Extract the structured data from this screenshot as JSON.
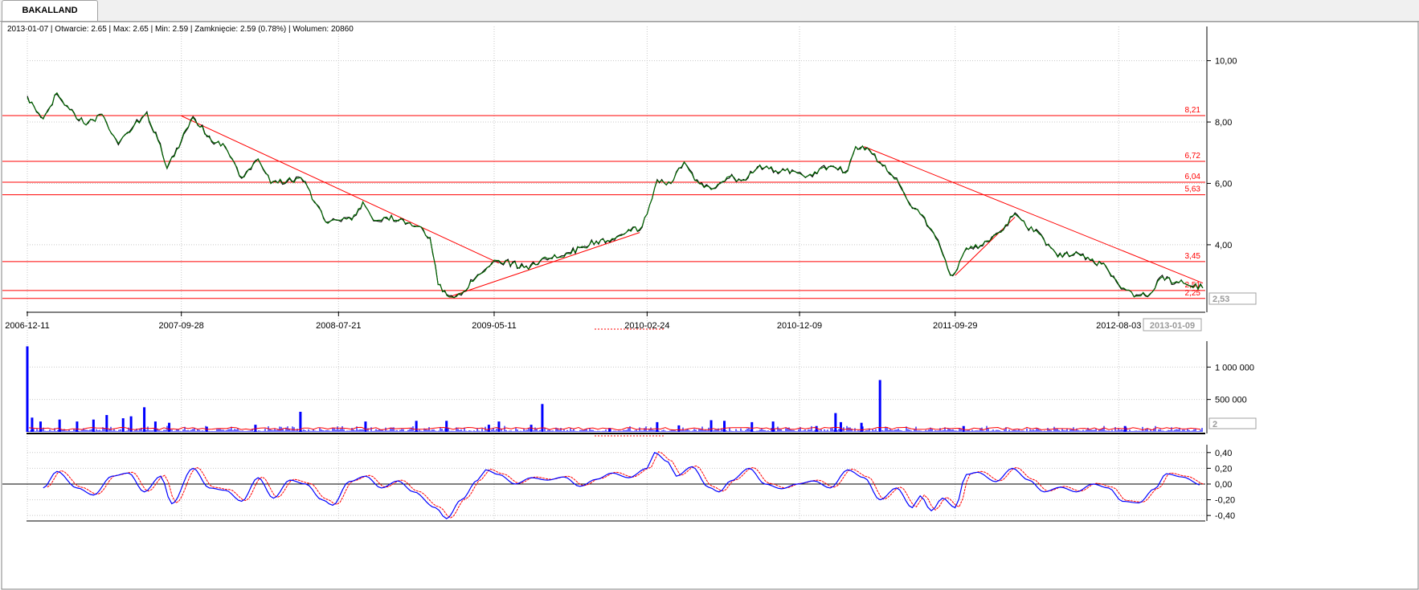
{
  "tab": {
    "label": "BAKALLAND"
  },
  "info_bar": "2013-01-07 | Otwarcie: 2.65 | Max: 2.65 | Min: 2.59 | Zamknięcie: 2.59 (0.78%)  | Wolumen: 20860",
  "colors": {
    "price_line": "#006400",
    "price_high_low": "#000000",
    "level_line": "#ff0000",
    "volume_bar": "#0000ff",
    "volume_ma": "#ff0000",
    "osc_main": "#0000ff",
    "osc_signal": "#ff0000",
    "grid": "#c8c8c8"
  },
  "chart_data": {
    "type": "line",
    "x_labels": [
      "2006-12-11",
      "2007-09-28",
      "2008-07-21",
      "2009-05-11",
      "2010-02-24",
      "2010-12-09",
      "2011-09-29",
      "2012-08-03"
    ],
    "x_range": [
      "2006-12-11",
      "2013-01-09"
    ],
    "current_date_label": "2013-01-09",
    "price_panel": {
      "y_ticks": [
        "10,00",
        "8,00",
        "6,00",
        "4,00"
      ],
      "ylim": [
        1.8,
        10.8
      ],
      "series": [
        {
          "name": "",
          "points": [
            [
              "2006-12-11",
              8.8
            ],
            [
              "2007-01-10",
              8.1
            ],
            [
              "2007-02-05",
              8.95
            ],
            [
              "2007-03-01",
              8.4
            ],
            [
              "2007-04-01",
              7.9
            ],
            [
              "2007-05-01",
              8.25
            ],
            [
              "2007-06-01",
              7.3
            ],
            [
              "2007-07-01",
              7.9
            ],
            [
              "2007-07-25",
              8.3
            ],
            [
              "2007-08-15",
              7.4
            ],
            [
              "2007-09-01",
              6.5
            ],
            [
              "2007-09-28",
              7.4
            ],
            [
              "2007-10-20",
              8.15
            ],
            [
              "2007-11-20",
              7.5
            ],
            [
              "2007-12-20",
              7.2
            ],
            [
              "2008-01-20",
              6.2
            ],
            [
              "2008-02-20",
              6.8
            ],
            [
              "2008-03-15",
              6.0
            ],
            [
              "2008-04-15",
              6.1
            ],
            [
              "2008-05-15",
              6.1
            ],
            [
              "2008-06-10",
              5.3
            ],
            [
              "2008-07-01",
              4.7
            ],
            [
              "2008-07-21",
              4.8
            ],
            [
              "2008-08-15",
              4.8
            ],
            [
              "2008-09-05",
              5.4
            ],
            [
              "2008-09-25",
              4.8
            ],
            [
              "2008-10-20",
              4.9
            ],
            [
              "2008-11-20",
              4.8
            ],
            [
              "2008-12-20",
              4.6
            ],
            [
              "2009-01-10",
              4.2
            ],
            [
              "2009-01-25",
              2.7
            ],
            [
              "2009-02-15",
              2.3
            ],
            [
              "2009-03-10",
              2.4
            ],
            [
              "2009-04-10",
              3.0
            ],
            [
              "2009-05-11",
              3.5
            ],
            [
              "2009-06-15",
              3.4
            ],
            [
              "2009-07-15",
              3.2
            ],
            [
              "2009-08-15",
              3.6
            ],
            [
              "2009-09-20",
              3.6
            ],
            [
              "2009-10-20",
              3.9
            ],
            [
              "2009-11-20",
              4.1
            ],
            [
              "2009-12-20",
              4.2
            ],
            [
              "2010-01-20",
              4.5
            ],
            [
              "2010-02-10",
              4.5
            ],
            [
              "2010-02-24",
              5.0
            ],
            [
              "2010-03-15",
              6.1
            ],
            [
              "2010-04-10",
              6.0
            ],
            [
              "2010-05-05",
              6.7
            ],
            [
              "2010-05-25",
              6.1
            ],
            [
              "2010-06-25",
              5.8
            ],
            [
              "2010-07-25",
              6.2
            ],
            [
              "2010-08-25",
              6.1
            ],
            [
              "2010-09-25",
              6.6
            ],
            [
              "2010-10-25",
              6.4
            ],
            [
              "2010-11-25",
              6.4
            ],
            [
              "2010-12-20",
              6.2
            ],
            [
              "2011-01-20",
              6.5
            ],
            [
              "2011-02-15",
              6.5
            ],
            [
              "2011-03-10",
              6.4
            ],
            [
              "2011-03-25",
              7.2
            ],
            [
              "2011-04-20",
              7.1
            ],
            [
              "2011-05-15",
              6.6
            ],
            [
              "2011-06-15",
              6.0
            ],
            [
              "2011-07-05",
              5.3
            ],
            [
              "2011-07-25",
              5.0
            ],
            [
              "2011-08-15",
              4.5
            ],
            [
              "2011-09-01",
              3.9
            ],
            [
              "2011-09-20",
              3.0
            ],
            [
              "2011-09-29",
              3.1
            ],
            [
              "2011-10-20",
              3.9
            ],
            [
              "2011-11-20",
              4.0
            ],
            [
              "2011-12-20",
              4.4
            ],
            [
              "2012-01-20",
              5.0
            ],
            [
              "2012-02-10",
              4.6
            ],
            [
              "2012-03-10",
              4.3
            ],
            [
              "2012-04-10",
              3.6
            ],
            [
              "2012-05-10",
              3.7
            ],
            [
              "2012-06-10",
              3.5
            ],
            [
              "2012-07-10",
              3.3
            ],
            [
              "2012-08-03",
              2.7
            ],
            [
              "2012-09-01",
              2.3
            ],
            [
              "2012-10-01",
              2.4
            ],
            [
              "2012-10-20",
              2.9
            ],
            [
              "2012-11-20",
              2.8
            ],
            [
              "2013-01-09",
              2.59
            ]
          ]
        }
      ],
      "levels": [
        {
          "value": 8.21,
          "label": "8,21"
        },
        {
          "value": 6.72,
          "label": "6,72"
        },
        {
          "value": 6.04,
          "label": "6,04"
        },
        {
          "value": 5.63,
          "label": "5,63"
        },
        {
          "value": 3.45,
          "label": "3,45"
        },
        {
          "value": 2.51,
          "label": "2,51"
        },
        {
          "value": 2.25,
          "label": "2,25"
        }
      ],
      "trendlines": [
        {
          "from": [
            "2007-09-28",
            8.2
          ],
          "to": [
            "2009-05-20",
            3.4
          ]
        },
        {
          "from": [
            "2009-02-15",
            2.3
          ],
          "to": [
            "2010-02-10",
            4.4
          ]
        },
        {
          "from": [
            "2011-04-10",
            7.2
          ],
          "to": [
            "2013-01-09",
            2.75
          ]
        },
        {
          "from": [
            "2011-09-29",
            3.0
          ],
          "to": [
            "2012-01-20",
            4.9
          ]
        }
      ],
      "current_value_label": "2,53"
    },
    "volume_panel": {
      "y_ticks": [
        "1 000 000",
        "500 000"
      ],
      "ylim": [
        0,
        1400000
      ],
      "current_value_label": "2",
      "spikes": [
        [
          "2006-12-11",
          1320000
        ],
        [
          "2006-12-20",
          220000
        ],
        [
          "2007-01-05",
          160000
        ],
        [
          "2007-02-10",
          190000
        ],
        [
          "2007-03-15",
          160000
        ],
        [
          "2007-04-15",
          190000
        ],
        [
          "2007-05-10",
          260000
        ],
        [
          "2007-06-10",
          210000
        ],
        [
          "2007-06-25",
          240000
        ],
        [
          "2007-07-20",
          380000
        ],
        [
          "2007-08-10",
          160000
        ],
        [
          "2007-09-05",
          140000
        ],
        [
          "2007-11-15",
          80000
        ],
        [
          "2008-02-15",
          110000
        ],
        [
          "2008-05-10",
          310000
        ],
        [
          "2008-09-10",
          160000
        ],
        [
          "2008-12-15",
          170000
        ],
        [
          "2009-02-10",
          170000
        ],
        [
          "2009-05-01",
          110000
        ],
        [
          "2009-05-20",
          160000
        ],
        [
          "2009-07-20",
          110000
        ],
        [
          "2009-08-10",
          430000
        ],
        [
          "2009-12-15",
          60000
        ],
        [
          "2010-03-15",
          150000
        ],
        [
          "2010-04-25",
          100000
        ],
        [
          "2010-06-25",
          180000
        ],
        [
          "2010-07-20",
          170000
        ],
        [
          "2010-09-10",
          150000
        ],
        [
          "2010-10-20",
          160000
        ],
        [
          "2011-01-10",
          90000
        ],
        [
          "2011-02-15",
          290000
        ],
        [
          "2011-02-25",
          150000
        ],
        [
          "2011-04-05",
          140000
        ],
        [
          "2011-05-10",
          800000
        ],
        [
          "2011-10-15",
          90000
        ],
        [
          "2012-08-15",
          90000
        ]
      ]
    },
    "oscillator_panel": {
      "y_ticks": [
        "0,40",
        "0,20",
        "0,00",
        "-0,20",
        "-0,40"
      ],
      "ylim": [
        -0.48,
        0.5
      ],
      "series": [
        {
          "name": "",
          "points": [
            [
              "2007-01-10",
              -0.05
            ],
            [
              "2007-02-05",
              0.16
            ],
            [
              "2007-03-15",
              -0.05
            ],
            [
              "2007-04-15",
              -0.14
            ],
            [
              "2007-05-20",
              0.1
            ],
            [
              "2007-06-20",
              0.14
            ],
            [
              "2007-07-20",
              -0.1
            ],
            [
              "2007-08-20",
              0.1
            ],
            [
              "2007-09-10",
              -0.25
            ],
            [
              "2007-10-20",
              0.2
            ],
            [
              "2007-11-20",
              -0.05
            ],
            [
              "2007-12-20",
              -0.08
            ],
            [
              "2008-01-20",
              -0.22
            ],
            [
              "2008-02-20",
              0.08
            ],
            [
              "2008-03-20",
              -0.18
            ],
            [
              "2008-04-20",
              0.05
            ],
            [
              "2008-05-20",
              0.0
            ],
            [
              "2008-06-20",
              -0.2
            ],
            [
              "2008-07-10",
              -0.27
            ],
            [
              "2008-08-10",
              0.03
            ],
            [
              "2008-09-10",
              0.1
            ],
            [
              "2008-10-10",
              -0.05
            ],
            [
              "2008-11-10",
              0.04
            ],
            [
              "2008-12-10",
              -0.1
            ],
            [
              "2009-01-20",
              -0.3
            ],
            [
              "2009-02-10",
              -0.44
            ],
            [
              "2009-03-10",
              -0.2
            ],
            [
              "2009-04-10",
              0.05
            ],
            [
              "2009-04-25",
              0.18
            ],
            [
              "2009-05-20",
              0.12
            ],
            [
              "2009-06-20",
              0.0
            ],
            [
              "2009-07-20",
              0.08
            ],
            [
              "2009-08-20",
              0.05
            ],
            [
              "2009-09-20",
              0.09
            ],
            [
              "2009-10-20",
              -0.03
            ],
            [
              "2009-11-20",
              0.06
            ],
            [
              "2009-12-20",
              0.14
            ],
            [
              "2010-01-20",
              0.08
            ],
            [
              "2010-02-24",
              0.2
            ],
            [
              "2010-03-10",
              0.4
            ],
            [
              "2010-04-05",
              0.28
            ],
            [
              "2010-04-20",
              0.1
            ],
            [
              "2010-05-20",
              0.22
            ],
            [
              "2010-06-20",
              -0.04
            ],
            [
              "2010-07-10",
              -0.1
            ],
            [
              "2010-08-01",
              0.04
            ],
            [
              "2010-09-05",
              0.2
            ],
            [
              "2010-10-05",
              0.0
            ],
            [
              "2010-11-05",
              -0.06
            ],
            [
              "2010-12-05",
              0.0
            ],
            [
              "2011-01-05",
              0.04
            ],
            [
              "2011-02-05",
              -0.05
            ],
            [
              "2011-03-10",
              0.18
            ],
            [
              "2011-04-10",
              0.08
            ],
            [
              "2011-05-10",
              -0.2
            ],
            [
              "2011-06-10",
              -0.05
            ],
            [
              "2011-07-10",
              -0.3
            ],
            [
              "2011-07-25",
              -0.15
            ],
            [
              "2011-08-15",
              -0.34
            ],
            [
              "2011-09-05",
              -0.18
            ],
            [
              "2011-09-29",
              -0.3
            ],
            [
              "2011-10-20",
              0.12
            ],
            [
              "2011-11-10",
              0.15
            ],
            [
              "2011-12-15",
              0.03
            ],
            [
              "2012-01-15",
              0.2
            ],
            [
              "2012-02-15",
              0.05
            ],
            [
              "2012-03-15",
              -0.1
            ],
            [
              "2012-04-15",
              -0.04
            ],
            [
              "2012-05-15",
              -0.1
            ],
            [
              "2012-06-15",
              0.0
            ],
            [
              "2012-07-15",
              -0.05
            ],
            [
              "2012-08-10",
              -0.22
            ],
            [
              "2012-09-10",
              -0.24
            ],
            [
              "2012-10-10",
              -0.06
            ],
            [
              "2012-11-01",
              0.13
            ],
            [
              "2012-12-01",
              0.09
            ],
            [
              "2013-01-09",
              -0.02
            ]
          ]
        }
      ]
    }
  }
}
